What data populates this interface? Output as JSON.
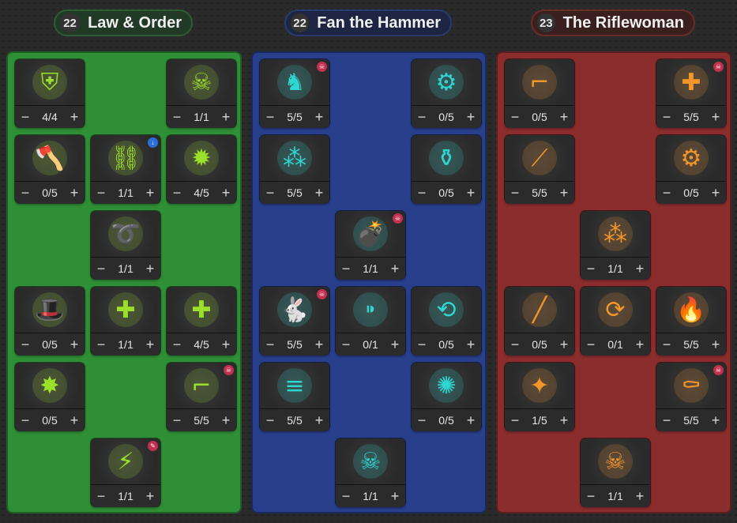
{
  "trees": [
    {
      "level": "22",
      "name": "Law & Order",
      "color": "#2f8f36",
      "header_bg": "#203a26",
      "header_border": "#2f5b36",
      "icon_color": "#9be02a",
      "nodes": [
        {
          "value": "4/4",
          "icon": "shield-badge-icon",
          "glyph": "⛨",
          "badge": ""
        },
        {
          "value": "1/1",
          "icon": "skull-badge-icon",
          "glyph": "☠",
          "badge": ""
        },
        {
          "value": "0/5",
          "icon": "hatchet-icon",
          "glyph": "🪓",
          "badge": ""
        },
        {
          "value": "1/1",
          "icon": "handcuffs-icon",
          "glyph": "⛓",
          "badge": "download"
        },
        {
          "value": "4/5",
          "icon": "sheriff-star-icon",
          "glyph": "✹",
          "badge": ""
        },
        {
          "value": "1/1",
          "icon": "rope-lasso-icon",
          "glyph": "➰",
          "badge": ""
        },
        {
          "value": "0/5",
          "icon": "hat-brush-icon",
          "glyph": "🎩",
          "badge": ""
        },
        {
          "value": "1/1",
          "icon": "noose-plus-icon",
          "glyph": "✚",
          "badge": ""
        },
        {
          "value": "4/5",
          "icon": "gun-plus-icon",
          "glyph": "✚",
          "badge": ""
        },
        {
          "value": "0/5",
          "icon": "shatter-arrow-icon",
          "glyph": "✸",
          "badge": ""
        },
        {
          "value": "5/5",
          "icon": "revolver-icon",
          "glyph": "⌐",
          "badge": "skull"
        },
        {
          "value": "1/1",
          "icon": "lightning-tree-icon",
          "glyph": "⚡",
          "badge": "pen"
        }
      ]
    },
    {
      "level": "22",
      "name": "Fan the Hammer",
      "color": "#283f8c",
      "header_bg": "#1d2542",
      "header_border": "#2b3a6e",
      "icon_color": "#2fd6d0",
      "nodes": [
        {
          "value": "5/5",
          "icon": "horse-icon",
          "glyph": "♞",
          "badge": "skull"
        },
        {
          "value": "0/5",
          "icon": "revolver-cylinder-icon",
          "glyph": "⚙",
          "badge": ""
        },
        {
          "value": "5/5",
          "icon": "ammo-stack-icon",
          "glyph": "⁂",
          "badge": ""
        },
        {
          "value": "0/5",
          "icon": "bottle-gun-icon",
          "glyph": "⚱",
          "badge": ""
        },
        {
          "value": "1/1",
          "icon": "bomb-icon",
          "glyph": "💣",
          "badge": "skull"
        },
        {
          "value": "5/5",
          "icon": "rabbit-icon",
          "glyph": "🐇",
          "badge": "skull"
        },
        {
          "value": "0/1",
          "icon": "bullets-icon",
          "glyph": "⁍",
          "badge": ""
        },
        {
          "value": "0/5",
          "icon": "gun-reload-icon",
          "glyph": "⟲",
          "badge": ""
        },
        {
          "value": "5/5",
          "icon": "dynamite-icon",
          "glyph": "≡",
          "badge": ""
        },
        {
          "value": "0/5",
          "icon": "gun-fire-icon",
          "glyph": "✺",
          "badge": ""
        },
        {
          "value": "1/1",
          "icon": "skull-crossed-guns-icon",
          "glyph": "☠",
          "badge": ""
        }
      ]
    },
    {
      "level": "23",
      "name": "The Riflewoman",
      "color": "#8c2d2d",
      "header_bg": "#3a1f1f",
      "header_border": "#6a2a2a",
      "icon_color": "#f2952a",
      "nodes": [
        {
          "value": "0/5",
          "icon": "rifle-hands-icon",
          "glyph": "⌐",
          "badge": ""
        },
        {
          "value": "5/5",
          "icon": "pistol-plus-icon",
          "glyph": "✚",
          "badge": "skull"
        },
        {
          "value": "5/5",
          "icon": "slash-cards-icon",
          "glyph": "⟋",
          "badge": ""
        },
        {
          "value": "0/5",
          "icon": "scope-mechanism-icon",
          "glyph": "⚙",
          "badge": ""
        },
        {
          "value": "1/1",
          "icon": "bullet-pile-icon",
          "glyph": "⁂",
          "badge": ""
        },
        {
          "value": "0/5",
          "icon": "rifle-barrel-icon",
          "glyph": "╱",
          "badge": ""
        },
        {
          "value": "0/1",
          "icon": "cylinder-arrow-icon",
          "glyph": "⟳",
          "badge": ""
        },
        {
          "value": "5/5",
          "icon": "burning-card-icon",
          "glyph": "🔥",
          "badge": ""
        },
        {
          "value": "1/5",
          "icon": "muzzle-flash-icon",
          "glyph": "✦",
          "badge": ""
        },
        {
          "value": "5/5",
          "icon": "tombstone-icon",
          "glyph": "⚰",
          "badge": "skull"
        },
        {
          "value": "1/1",
          "icon": "skull-crossed-rifles-icon",
          "glyph": "☠",
          "badge": ""
        }
      ]
    }
  ],
  "controls": {
    "minus": "−",
    "plus": "+"
  }
}
